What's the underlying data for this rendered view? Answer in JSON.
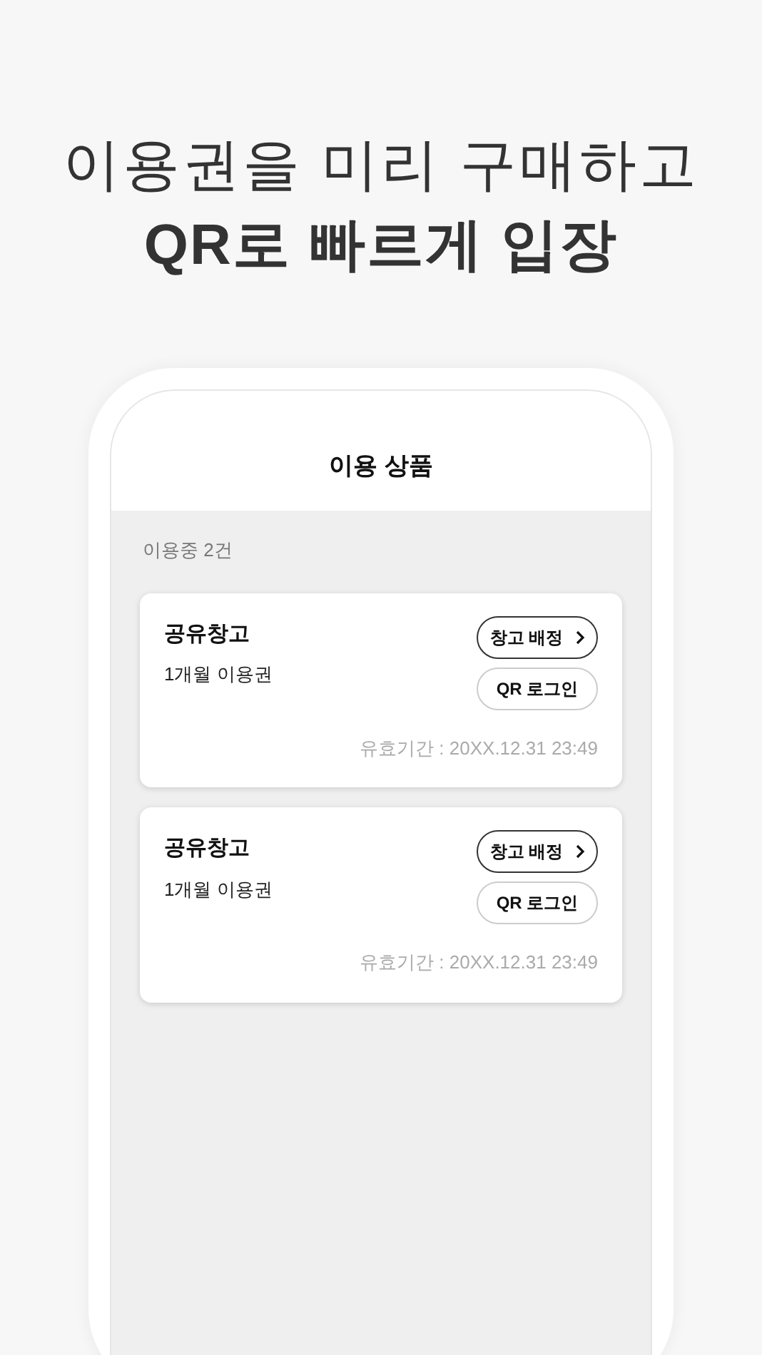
{
  "headline": {
    "line_1": "이용권을 미리 구매하고",
    "line_2": "QR로 빠르게 입장"
  },
  "screen": {
    "title": "이용 상품",
    "count_label": "이용중 2건",
    "cards": [
      {
        "name": "공유창고",
        "plan": "1개월 이용권",
        "validity": "유효기간 : 20XX.12.31 23:49",
        "buttons": [
          {
            "label": "창고 배정",
            "kind": "chevron"
          },
          {
            "label": "QR 로그인",
            "kind": "plain"
          }
        ]
      },
      {
        "name": "공유창고",
        "plan": "1개월 이용권",
        "validity": "유효기간 : 20XX.12.31 23:49",
        "buttons": [
          {
            "label": "창고 배정",
            "kind": "chevron"
          },
          {
            "label": "QR 로그인",
            "kind": "plain"
          }
        ]
      }
    ]
  }
}
